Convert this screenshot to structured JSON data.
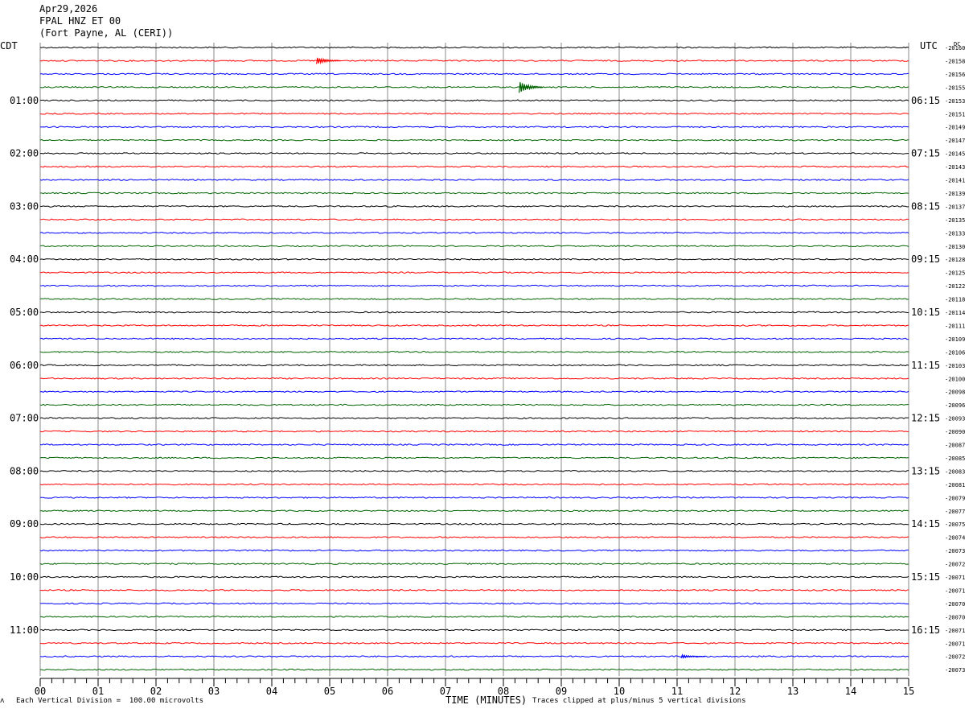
{
  "header": {
    "date": "Apr29,2026",
    "station": "FPAL HNZ ET 00",
    "location": "(Fort Payne, AL (CERI))"
  },
  "left_axis_label": "CDT",
  "right_axis_label": "UTC",
  "dc_label": "DC",
  "footer": {
    "scale_note": "Each Vertical Division =  100.00 microvolts",
    "clip_note": "Traces clipped at plus/minus 5 vertical divisions",
    "corner_mark": "ʌ"
  },
  "chart_data": {
    "type": "line",
    "xlabel": "TIME (MINUTES)",
    "x_ticks": [
      "00",
      "01",
      "02",
      "03",
      "04",
      "05",
      "06",
      "07",
      "08",
      "09",
      "10",
      "11",
      "12",
      "13",
      "14",
      "15"
    ],
    "xlim": [
      0,
      15
    ],
    "trace_colors": [
      "#000000",
      "#ff0000",
      "#0000ff",
      "#006400"
    ],
    "left_time_labels": [
      "01:00",
      "02:00",
      "03:00",
      "04:00",
      "05:00",
      "06:00",
      "07:00",
      "08:00",
      "09:00",
      "10:00",
      "11:00"
    ],
    "right_time_labels": [
      "06:15",
      "07:15",
      "08:15",
      "09:15",
      "10:15",
      "11:15",
      "12:15",
      "13:15",
      "14:15",
      "15:15",
      "16:15"
    ],
    "dc_offsets": [
      "-20160",
      "-20158",
      "-20156",
      "-20155",
      "-20153",
      "-20151",
      "-20149",
      "-20147",
      "-20145",
      "-20143",
      "-20141",
      "-20139",
      "-20137",
      "-20135",
      "-20133",
      "-20130",
      "-20128",
      "-20125",
      "-20122",
      "-20118",
      "-20114",
      "-20111",
      "-20109",
      "-20106",
      "-20103",
      "-20100",
      "-20098",
      "-20096",
      "-20093",
      "-20090",
      "-20087",
      "-20085",
      "-20083",
      "-20081",
      "-20079",
      "-20077",
      "-20075",
      "-20074",
      "-20073",
      "-20072",
      "-20071",
      "-20071",
      "-20070",
      "-20070",
      "-20071",
      "-20071",
      "-20072",
      "-20073"
    ],
    "events": [
      {
        "trace": 1,
        "minute": 4.8,
        "amplitude": 4
      },
      {
        "trace": 3,
        "minute": 8.3,
        "amplitude": 7
      },
      {
        "trace": 46,
        "minute": 11.1,
        "amplitude": 2
      }
    ]
  }
}
